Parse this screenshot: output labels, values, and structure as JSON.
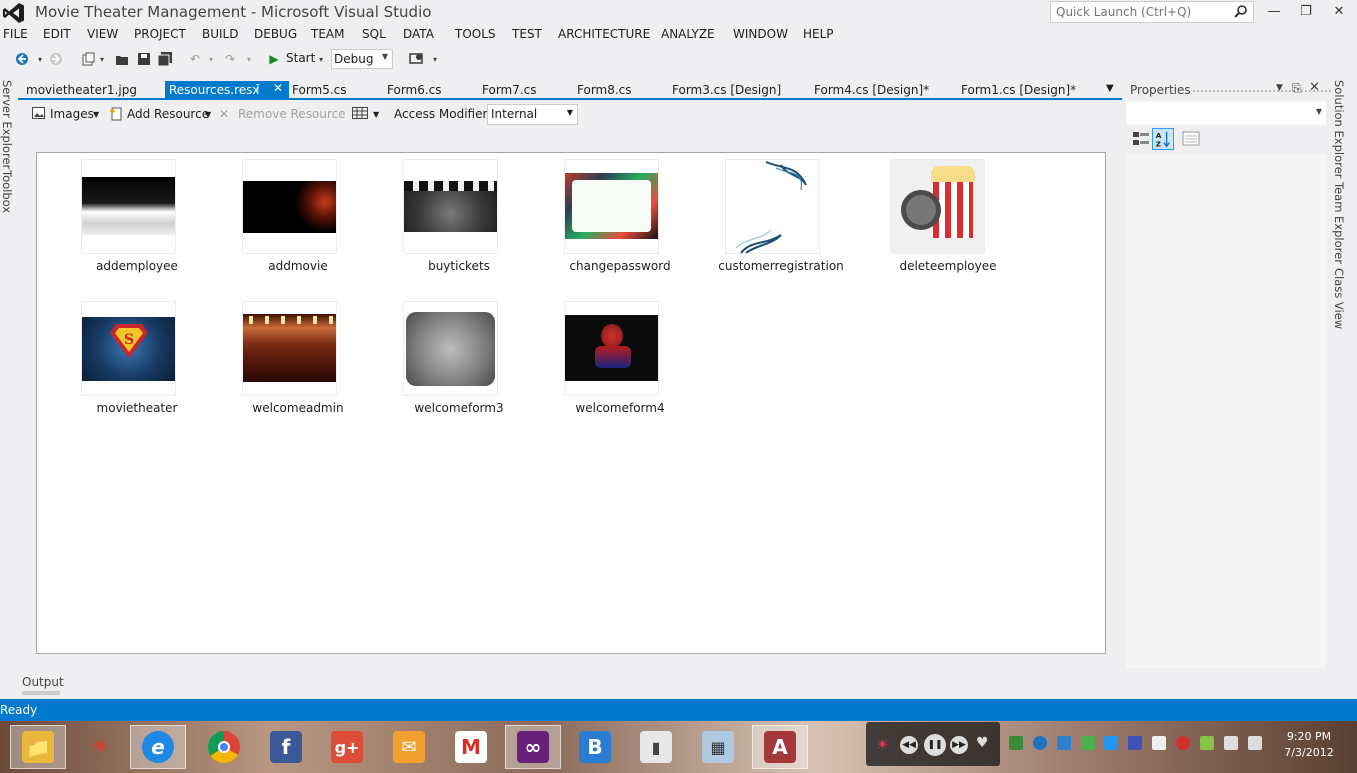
{
  "window": {
    "title": "Movie Theater Management - Microsoft Visual Studio",
    "quick_launch_placeholder": "Quick Launch (Ctrl+Q)"
  },
  "menu": [
    "FILE",
    "EDIT",
    "VIEW",
    "PROJECT",
    "BUILD",
    "DEBUG",
    "TEAM",
    "SQL",
    "DATA",
    "TOOLS",
    "TEST",
    "ARCHITECTURE",
    "ANALYZE",
    "WINDOW",
    "HELP"
  ],
  "toolbar": {
    "start_label": "Start",
    "config_value": "Debug"
  },
  "left_sidebar": {
    "server_explorer": "Server Explorer",
    "toolbox": "Toolbox"
  },
  "tabs": [
    {
      "label": "movietheater1.jpg",
      "active": false
    },
    {
      "label": "Resources.resx",
      "active": true
    },
    {
      "label": "Form5.cs",
      "active": false
    },
    {
      "label": "Form6.cs",
      "active": false
    },
    {
      "label": "Form7.cs",
      "active": false
    },
    {
      "label": "Form8.cs",
      "active": false
    },
    {
      "label": "Form3.cs [Design]",
      "active": false
    },
    {
      "label": "Form4.cs [Design]*",
      "active": false
    },
    {
      "label": "Form1.cs [Design]*",
      "active": false
    }
  ],
  "resource_toolbar": {
    "category": "Images",
    "add_resource": "Add Resource",
    "remove_resource": "Remove Resource",
    "access_modifier_label": "Access Modifier:",
    "access_modifier_value": "Internal"
  },
  "resources": [
    {
      "name": "addemployee",
      "icon": "employee-thumbnail"
    },
    {
      "name": "addmovie",
      "icon": "ironman-thumbnail"
    },
    {
      "name": "buytickets",
      "icon": "clapperboard-thumbnail"
    },
    {
      "name": "changepassword",
      "icon": "floral-frame-thumbnail"
    },
    {
      "name": "customerregistration",
      "icon": "swirl-thumbnail"
    },
    {
      "name": "deleteemployee",
      "icon": "popcorn-film-reel-thumbnail"
    },
    {
      "name": "movietheater",
      "icon": "superman-thumbnail"
    },
    {
      "name": "welcomeadmin",
      "icon": "theater-stage-thumbnail"
    },
    {
      "name": "welcomeform3",
      "icon": "grunge-frame-thumbnail"
    },
    {
      "name": "welcomeform4",
      "icon": "spiderman-thumbnail"
    }
  ],
  "properties_panel": {
    "title": "Properties"
  },
  "right_sidebar": {
    "solution_explorer": "Solution Explorer",
    "team_explorer": "Team Explorer",
    "class_view": "Class View"
  },
  "output_tab": "Output",
  "status": "Ready",
  "taskbar_apps": [
    "file-explorer",
    "app-star",
    "internet-explorer",
    "chrome",
    "facebook",
    "google-plus",
    "mail",
    "gmail",
    "visual-studio",
    "bing",
    "tablet-app",
    "windows-app",
    "access"
  ],
  "clock": {
    "time": "9:20 PM",
    "date": "7/3/2012"
  },
  "colors": {
    "accent": "#007acc",
    "chrome_bg": "#efeff2"
  }
}
